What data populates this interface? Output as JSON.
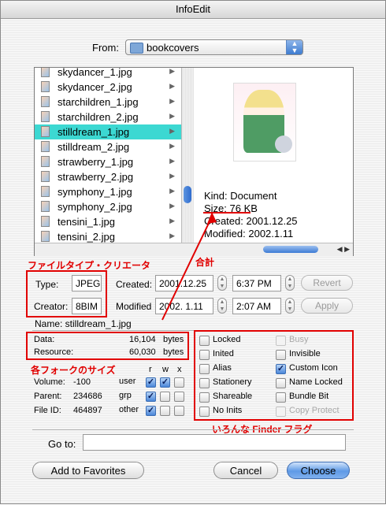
{
  "window": {
    "title": "InfoEdit"
  },
  "from": {
    "label": "From:",
    "folder": "bookcovers"
  },
  "files": [
    {
      "name": "skydancer_1.jpg",
      "selected": false
    },
    {
      "name": "skydancer_2.jpg",
      "selected": false
    },
    {
      "name": "starchildren_1.jpg",
      "selected": false
    },
    {
      "name": "starchildren_2.jpg",
      "selected": false
    },
    {
      "name": "stilldream_1.jpg",
      "selected": true
    },
    {
      "name": "stilldream_2.jpg",
      "selected": false
    },
    {
      "name": "strawberry_1.jpg",
      "selected": false
    },
    {
      "name": "strawberry_2.jpg",
      "selected": false
    },
    {
      "name": "symphony_1.jpg",
      "selected": false
    },
    {
      "name": "symphony_2.jpg",
      "selected": false
    },
    {
      "name": "tensini_1.jpg",
      "selected": false
    },
    {
      "name": "tensini_2.jpg",
      "selected": false
    }
  ],
  "preview": {
    "kind": "Kind: Document",
    "size": "Size: 76 KB",
    "created": "Created: 2001.12.25",
    "modified": "Modified: 2002.1.11"
  },
  "fields": {
    "type_label": "Type:",
    "type_value": "JPEG",
    "creator_label": "Creator:",
    "creator_value": "8BIM",
    "created_label": "Created:",
    "created_date": "2001.12.25",
    "created_time": "6:37 PM",
    "modified_label": "Modified",
    "modified_date": "2002.  1.11",
    "modified_time": "2:07 AM",
    "revert": "Revert",
    "apply": "Apply",
    "name_line": "Name: stilldream_1.jpg"
  },
  "forks": {
    "data_label": "Data:",
    "data_value": "16,104",
    "data_unit": "bytes",
    "resource_label": "Resource:",
    "resource_value": "60,030",
    "resource_unit": "bytes"
  },
  "perms": {
    "headers": [
      "r",
      "w",
      "x"
    ],
    "volume_label": "Volume:",
    "volume_value": "-100",
    "parent_label": "Parent:",
    "parent_value": "234686",
    "fileid_label": "File ID:",
    "fileid_value": "464897",
    "rows": [
      {
        "role": "user",
        "r": true,
        "w": true,
        "x": false
      },
      {
        "role": "grp",
        "r": true,
        "w": false,
        "x": false
      },
      {
        "role": "other",
        "r": true,
        "w": false,
        "x": false
      }
    ]
  },
  "flags_left": [
    {
      "label": "Locked",
      "checked": false,
      "disabled": false
    },
    {
      "label": "Inited",
      "checked": false,
      "disabled": false
    },
    {
      "label": "Alias",
      "checked": false,
      "disabled": false
    },
    {
      "label": "Stationery",
      "checked": false,
      "disabled": false
    },
    {
      "label": "Shareable",
      "checked": false,
      "disabled": false
    },
    {
      "label": "No Inits",
      "checked": false,
      "disabled": false
    }
  ],
  "flags_right": [
    {
      "label": "Busy",
      "checked": false,
      "disabled": true
    },
    {
      "label": "Invisible",
      "checked": false,
      "disabled": false
    },
    {
      "label": "Custom Icon",
      "checked": true,
      "disabled": false
    },
    {
      "label": "Name Locked",
      "checked": false,
      "disabled": false
    },
    {
      "label": "Bundle Bit",
      "checked": false,
      "disabled": false
    },
    {
      "label": "Copy Protect",
      "checked": false,
      "disabled": true
    }
  ],
  "goto": {
    "label": "Go to:",
    "value": ""
  },
  "buttons": {
    "favorites": "Add to Favorites",
    "cancel": "Cancel",
    "choose": "Choose"
  },
  "annotations": {
    "filetype": "ファイルタイプ・クリエータ",
    "total": "合計",
    "forksize": "各フォークのサイズ",
    "finderflags": "いろんな Finder フラグ"
  },
  "colors": {
    "annotation": "#e10000",
    "selection": "#3cd8d2",
    "accent": "#3f7fd8"
  }
}
